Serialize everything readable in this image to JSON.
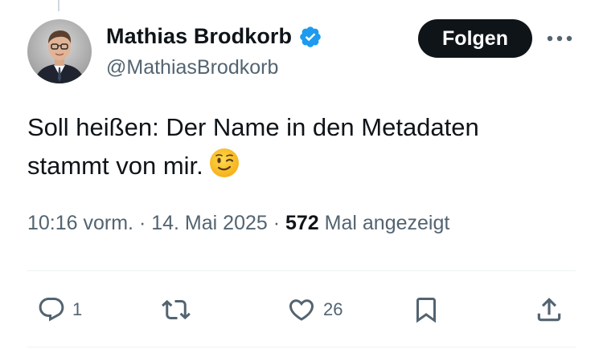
{
  "author": {
    "display_name": "Mathias Brodkorb",
    "handle": "@MathiasBrodkorb",
    "verified": true
  },
  "follow_button": {
    "label": "Folgen"
  },
  "tweet": {
    "text_lines": [
      "Soll heißen: Der Name in den Metadaten",
      "stammt von mir."
    ],
    "emoji": "winking-face"
  },
  "meta": {
    "time": "10:16 vorm.",
    "separator": " · ",
    "date": "14. Mai 2025",
    "views_count": "572",
    "views_label": " Mal angezeigt"
  },
  "actions": {
    "reply_count": "1",
    "repost_count": "",
    "like_count": "26"
  },
  "colors": {
    "text_primary": "#0f1419",
    "text_secondary": "#536471",
    "verified_blue": "#1d9bf0",
    "divider": "#eff3f4"
  }
}
